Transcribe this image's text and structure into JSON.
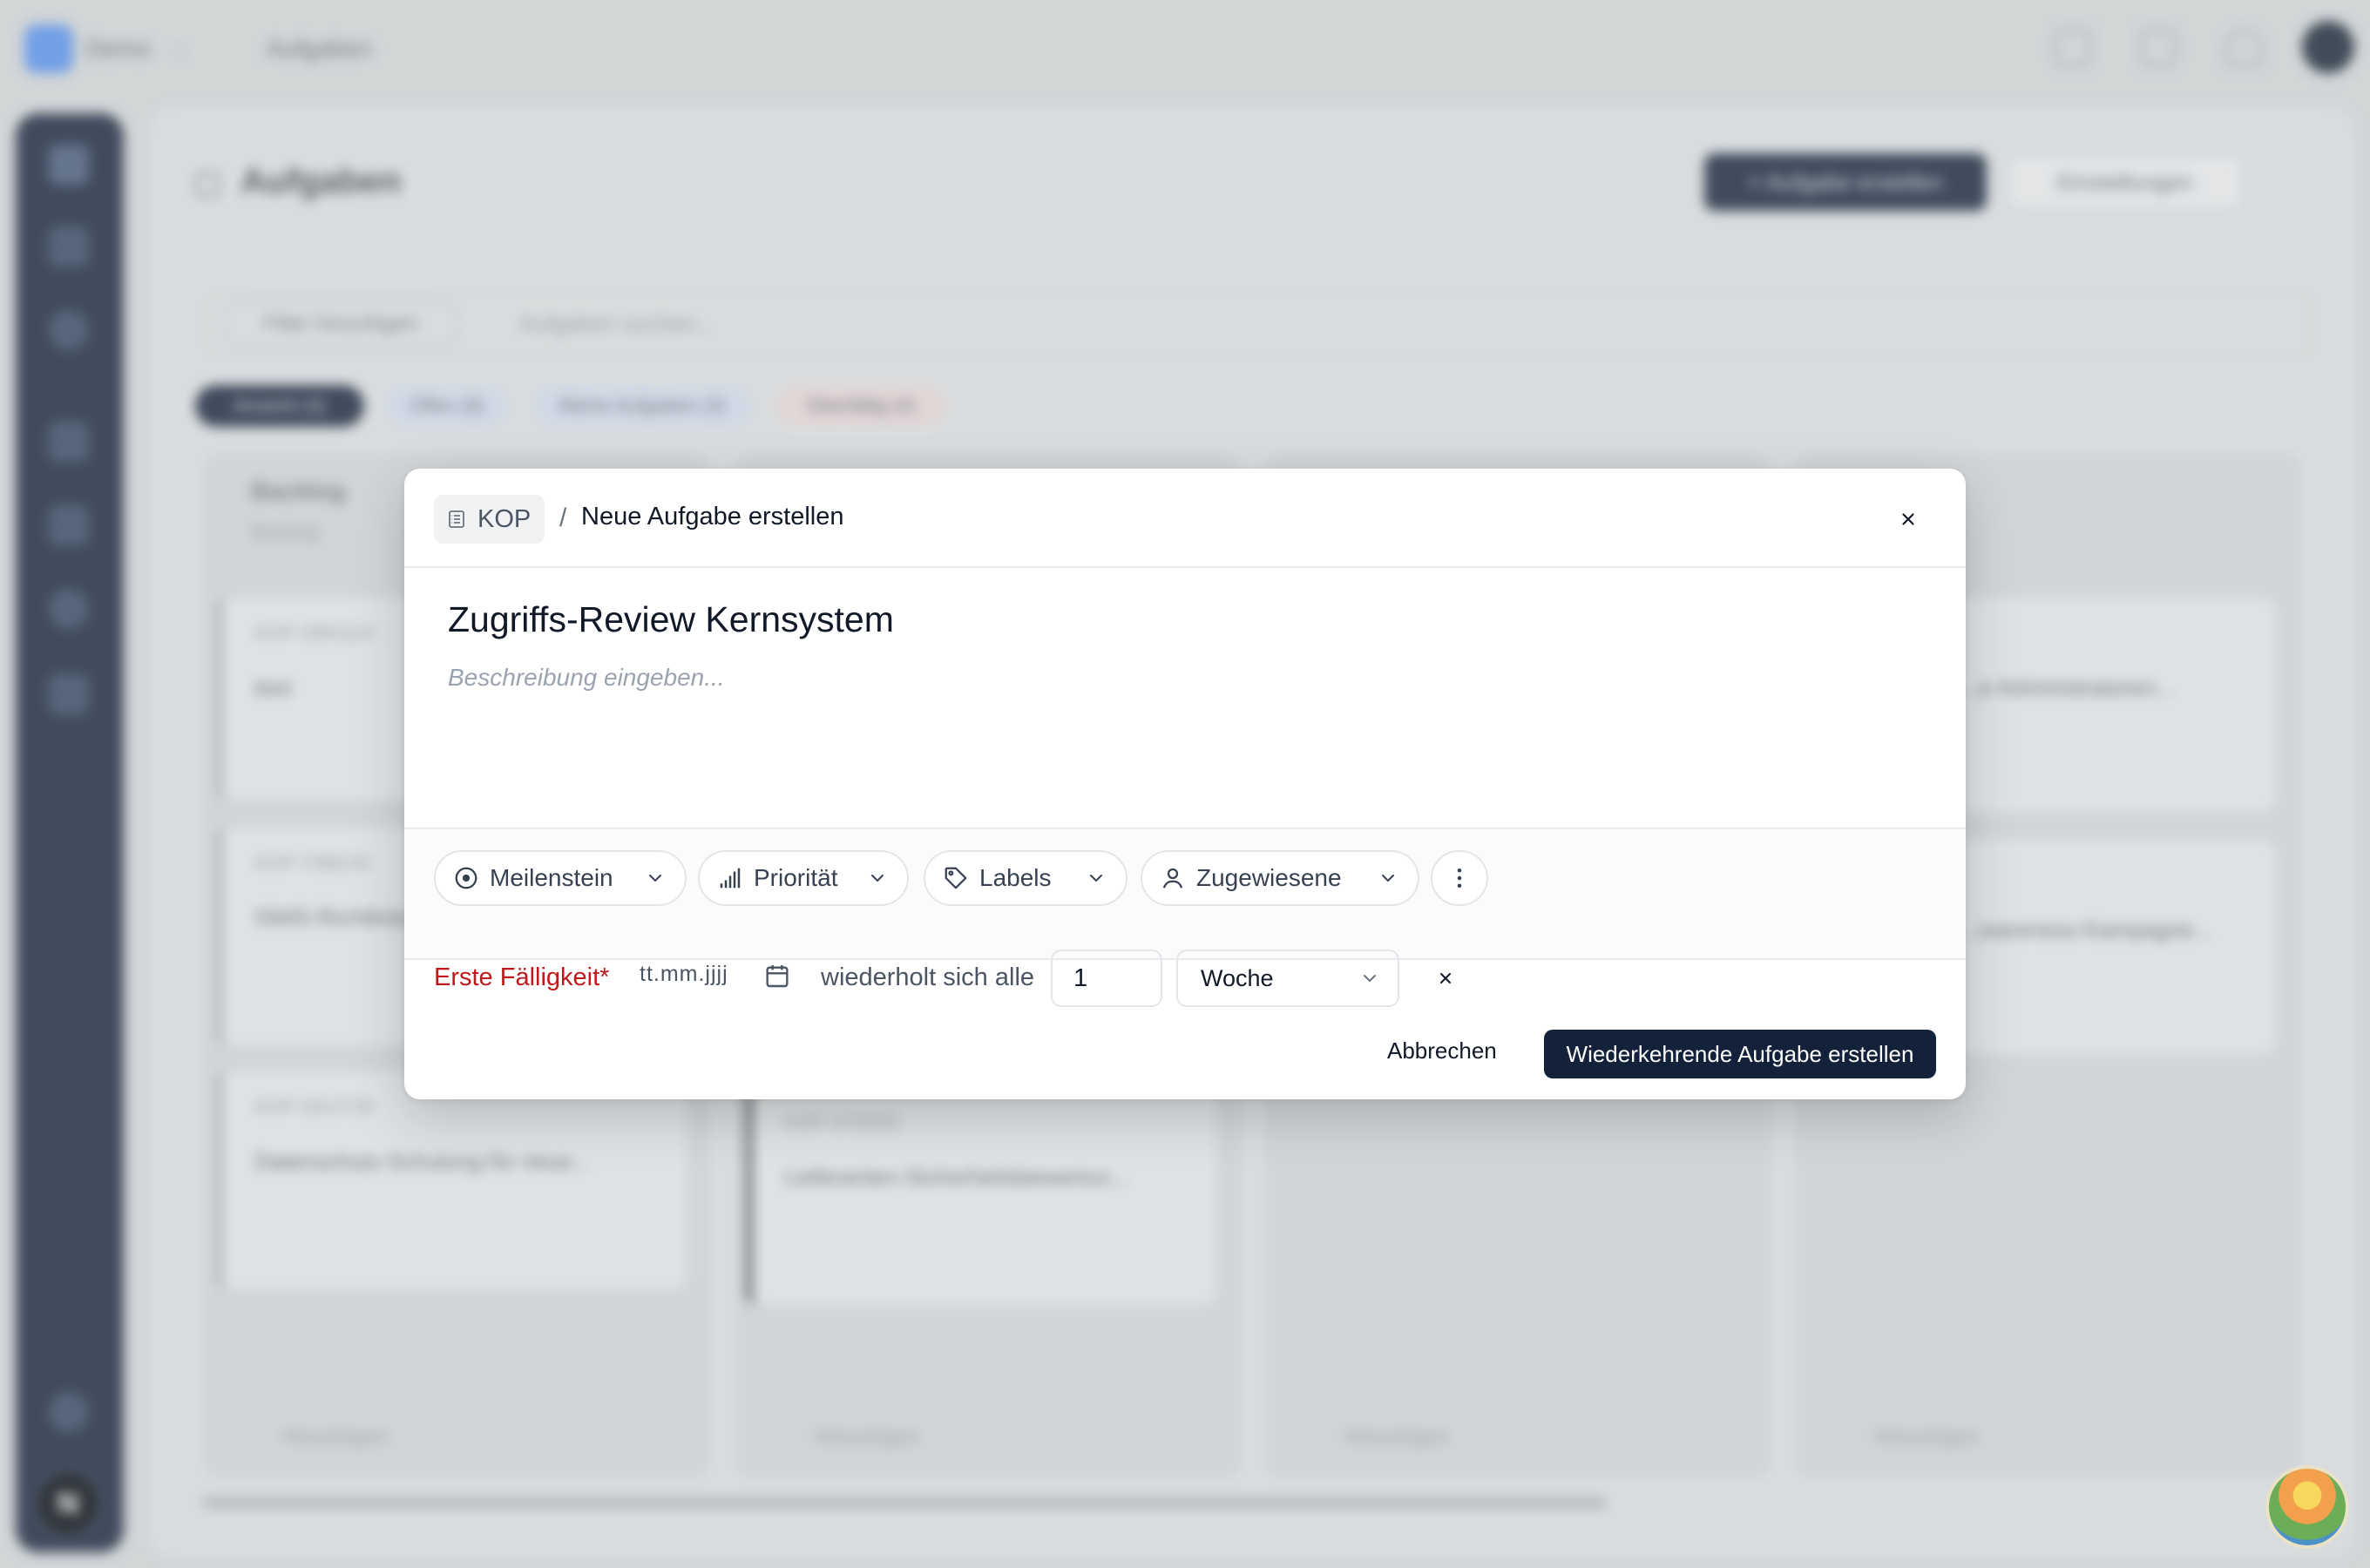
{
  "background": {
    "workspace": "Demo",
    "breadcrumb": "Aufgaben",
    "page_title": "Aufgaben",
    "create_button": "+ Aufgabe erstellen",
    "settings_button": "Einstellungen",
    "filter_button": "Filter hinzufügen",
    "search_placeholder": "Aufgaben suchen...",
    "tabs": [
      "Ansicht (3)",
      "Offen (8)",
      "Meine Aufgaben (3)",
      "Überfällig (4)"
    ],
    "columns": [
      {
        "title": "Backlog",
        "subtitle": "Backlog",
        "cards": [
          {
            "id": "KOP-ZBKQ24",
            "title": "test"
          },
          {
            "id": "KOP-Y9BZ40",
            "title": "ISMS-Richtlinie"
          },
          {
            "id": "KOP-3DUT28",
            "title": "Datenschutz-Schulung für neue..."
          }
        ]
      },
      {
        "title": "",
        "subtitle": "",
        "cards": [
          {
            "id": "KOP-372KE5",
            "title": "Lieferanten-Sicherheitsbewertun..."
          }
        ]
      },
      {
        "title": "",
        "subtitle": "",
        "cards": []
      },
      {
        "title": "",
        "subtitle": "",
        "cards": [
          {
            "id": "",
            "title": "...e Administratoren..."
          },
          {
            "id": "",
            "title": "...wareness-Kampagne..."
          }
        ]
      }
    ],
    "add_label": "Hinzufügen",
    "nav_avatar_letter": "N"
  },
  "modal": {
    "project": "KOP",
    "separator": "/",
    "title": "Neue Aufgabe erstellen",
    "task_name": "Zugriffs-Review Kernsystem",
    "description_placeholder": "Beschreibung eingeben...",
    "properties": {
      "milestone": "Meilenstein",
      "priority": "Priorität",
      "labels": "Labels",
      "assignees": "Zugewiesene"
    },
    "due_label": "Erste Fälligkeit*",
    "date_placeholder": "tt.mm.jjjj",
    "repeat_label": "wiederholt sich alle",
    "repeat_interval": "1",
    "repeat_unit": "Woche",
    "cancel_button": "Abbrechen",
    "submit_button": "Wiederkehrende Aufgabe erstellen",
    "colors": {
      "primary_button": "#13213a",
      "required_label": "#c0191b"
    }
  }
}
